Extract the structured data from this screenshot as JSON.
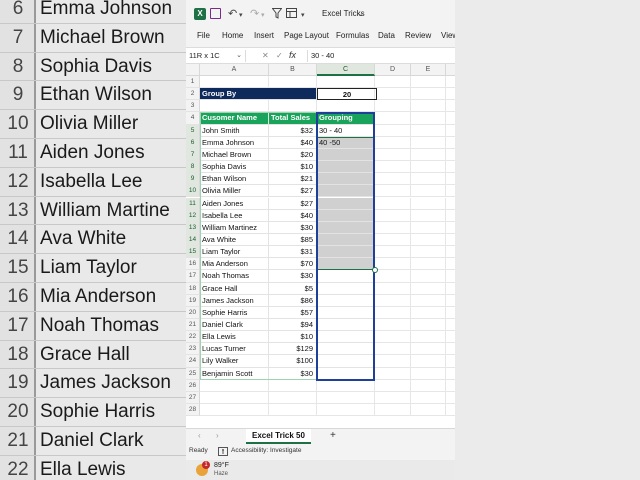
{
  "background_rows": [
    {
      "num": "6",
      "name": "Emma Johnson"
    },
    {
      "num": "7",
      "name": "Michael Brown"
    },
    {
      "num": "8",
      "name": "Sophia Davis"
    },
    {
      "num": "9",
      "name": "Ethan Wilson"
    },
    {
      "num": "10",
      "name": "Olivia Miller"
    },
    {
      "num": "11",
      "name": "Aiden Jones"
    },
    {
      "num": "12",
      "name": "Isabella Lee"
    },
    {
      "num": "13",
      "name": "William Martine"
    },
    {
      "num": "14",
      "name": "Ava White"
    },
    {
      "num": "15",
      "name": "Liam Taylor"
    },
    {
      "num": "16",
      "name": "Mia Anderson"
    },
    {
      "num": "17",
      "name": "Noah Thomas"
    },
    {
      "num": "18",
      "name": "Grace Hall"
    },
    {
      "num": "19",
      "name": "James Jackson"
    },
    {
      "num": "20",
      "name": "Sophie Harris"
    },
    {
      "num": "21",
      "name": "Daniel Clark"
    },
    {
      "num": "22",
      "name": "Ella Lewis"
    }
  ],
  "titlebar": {
    "title": "Excel Tricks",
    "logo_letter": "X"
  },
  "menu": [
    "File",
    "Home",
    "Insert",
    "Page Layout",
    "Formulas",
    "Data",
    "Review",
    "View"
  ],
  "formula_bar": {
    "name_box": "11R x 1C",
    "fx": "fx",
    "content": "30 - 40"
  },
  "columns": [
    "A",
    "B",
    "C",
    "D",
    "E"
  ],
  "rows": [
    "1",
    "2",
    "3",
    "4",
    "5",
    "6",
    "7",
    "8",
    "9",
    "10",
    "11",
    "12",
    "13",
    "14",
    "15",
    "16",
    "17",
    "18",
    "19",
    "20",
    "21",
    "22",
    "23",
    "24",
    "25",
    "26",
    "27",
    "28"
  ],
  "group_by": {
    "label": "Group By",
    "value": "20"
  },
  "table": {
    "headers": [
      "Cusomer Name",
      "Total Sales",
      "Grouping"
    ],
    "names": [
      "John Smith",
      "Emma Johnson",
      "Michael Brown",
      "Sophia Davis",
      "Ethan Wilson",
      "Olivia Miller",
      "Aiden Jones",
      "Isabella Lee",
      "William Martinez",
      "Ava White",
      "Liam Taylor",
      "Mia Anderson",
      "Noah Thomas",
      "Grace Hall",
      "James Jackson",
      "Sophie Harris",
      "Daniel Clark",
      "Ella Lewis",
      "Lucas Turner",
      "Lily Walker",
      "Benjamin Scott"
    ],
    "sales": [
      "$32",
      "$40",
      "$20",
      "$10",
      "$21",
      "$27",
      "$27",
      "$40",
      "$30",
      "$85",
      "$31",
      "$70",
      "$30",
      "$5",
      "$86",
      "$57",
      "$94",
      "$10",
      "$129",
      "$100",
      "$30"
    ],
    "grouping": [
      "30 - 40",
      "40 -50",
      "",
      "",
      "",
      "",
      "",
      "",
      "",
      "",
      "",
      "",
      "",
      "",
      "",
      "",
      "",
      "",
      "",
      "",
      ""
    ]
  },
  "sheet_tab": "Excel Trick 50",
  "status": {
    "ready": "Ready",
    "accessibility": "Accessibility: Investigate"
  },
  "weather": {
    "temp": "89°F",
    "desc": "Haze",
    "badge": "1"
  },
  "colors": {
    "excel_green": "#1e7145",
    "header_green": "#1aa35a",
    "navy": "#0e2a5c",
    "blue_box": "#1e3f9a"
  }
}
